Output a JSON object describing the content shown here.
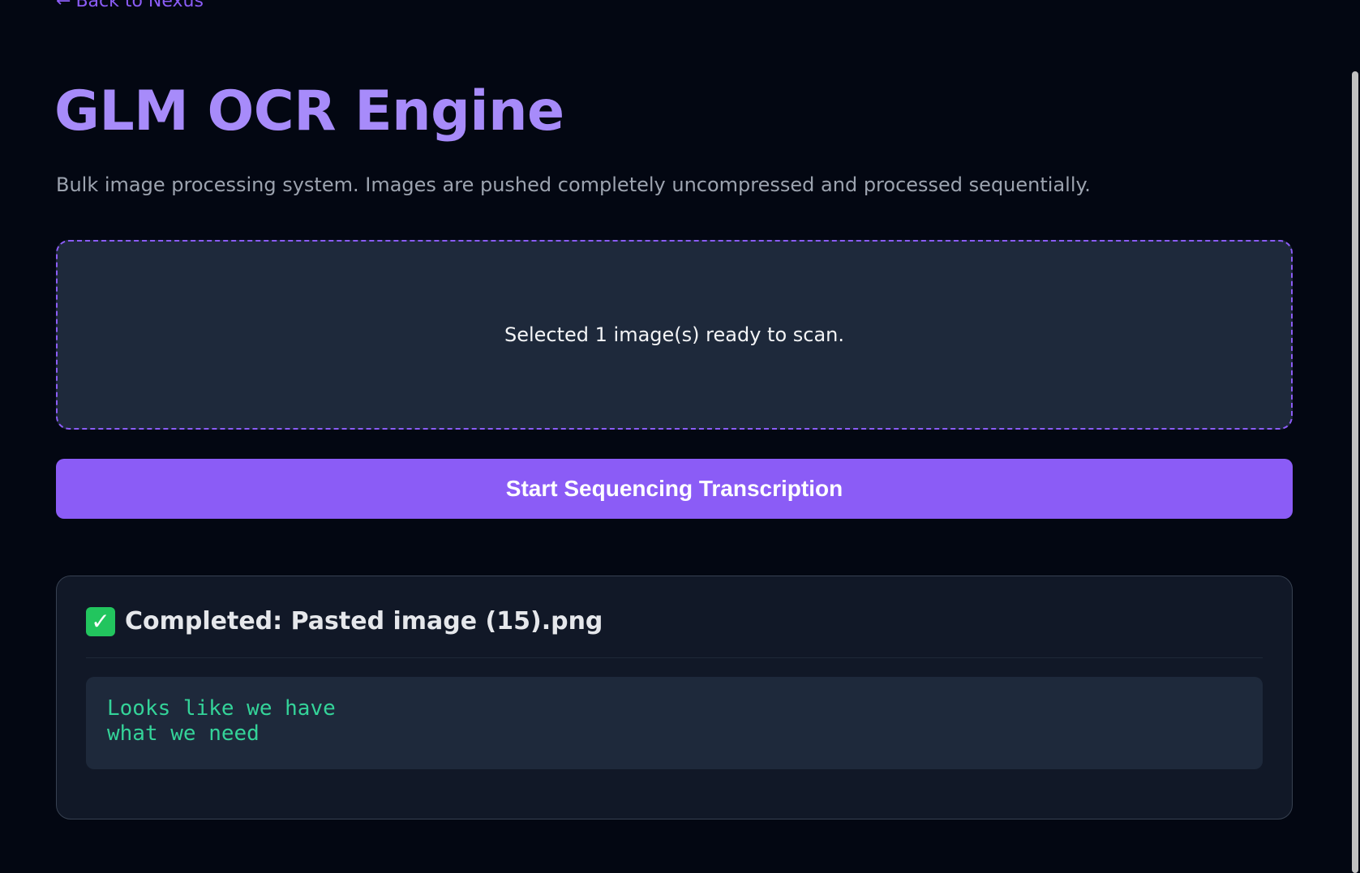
{
  "nav": {
    "back_arrow": "←",
    "back_label": "Back to Nexus"
  },
  "header": {
    "title": "GLM OCR Engine",
    "subtitle": "Bulk image processing system. Images are pushed completely uncompressed and processed sequentially."
  },
  "dropzone": {
    "status_text": "Selected 1 image(s) ready to scan."
  },
  "actions": {
    "start_label": "Start Sequencing Transcription"
  },
  "result": {
    "status_icon": "check-mark-icon",
    "status_glyph": "✓",
    "title": "Completed: Pasted image (15).png",
    "output_text": "Looks like we have\nwhat we need"
  },
  "colors": {
    "accent": "#8b5cf6",
    "title": "#a78bfa",
    "background": "#030712",
    "panel": "#1e293b",
    "output_text": "#34d399",
    "success": "#22c55e"
  }
}
